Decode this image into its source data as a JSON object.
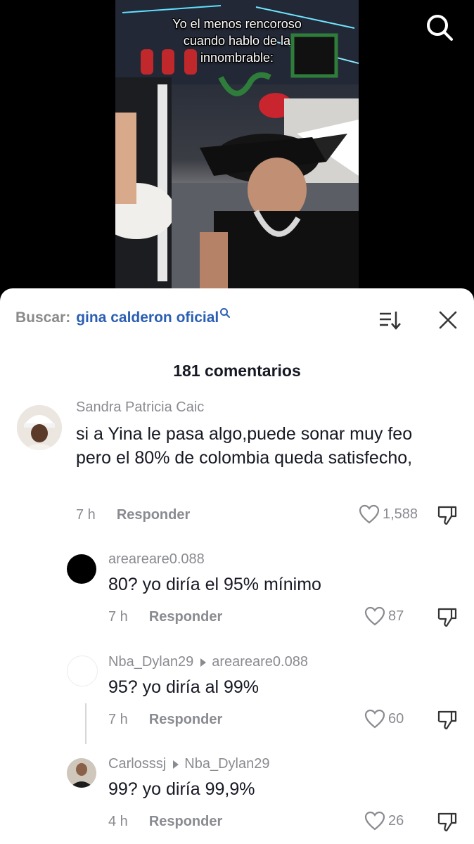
{
  "video": {
    "caption": "Yo el menos rencoroso\ncuando hablo de la\ninnombrable:"
  },
  "top_bar": {
    "search_icon": "search-icon"
  },
  "sheet": {
    "search_prefix": "Buscar:",
    "search_query": "gina calderon oficial",
    "sort_icon": "sort-icon",
    "close_icon": "close-icon",
    "comment_count": "181 comentarios"
  },
  "comments": [
    {
      "user": "Sandra Patricia Caic",
      "text": "si a Yina le pasa algo,puede sonar muy feo pero el 80% de colombia queda satisfecho,",
      "time": "7 h",
      "reply_label": "Responder",
      "likes": "1,588"
    },
    {
      "user": "areareare0.088",
      "text": "80? yo diría el 95% mínimo",
      "time": "7 h",
      "reply_label": "Responder",
      "likes": "87"
    },
    {
      "user": "Nba_Dylan29",
      "reply_to": "areareare0.088",
      "text": "95? yo diría al 99%",
      "time": "7 h",
      "reply_label": "Responder",
      "likes": "60"
    },
    {
      "user": "Carlosssj",
      "reply_to": "Nba_Dylan29",
      "text": "99? yo diría 99,9%",
      "time": "4 h",
      "reply_label": "Responder",
      "likes": "26"
    }
  ],
  "colors": {
    "link_blue": "#2b5fb3",
    "meta_gray": "#8a8b91",
    "text_dark": "#161823"
  }
}
